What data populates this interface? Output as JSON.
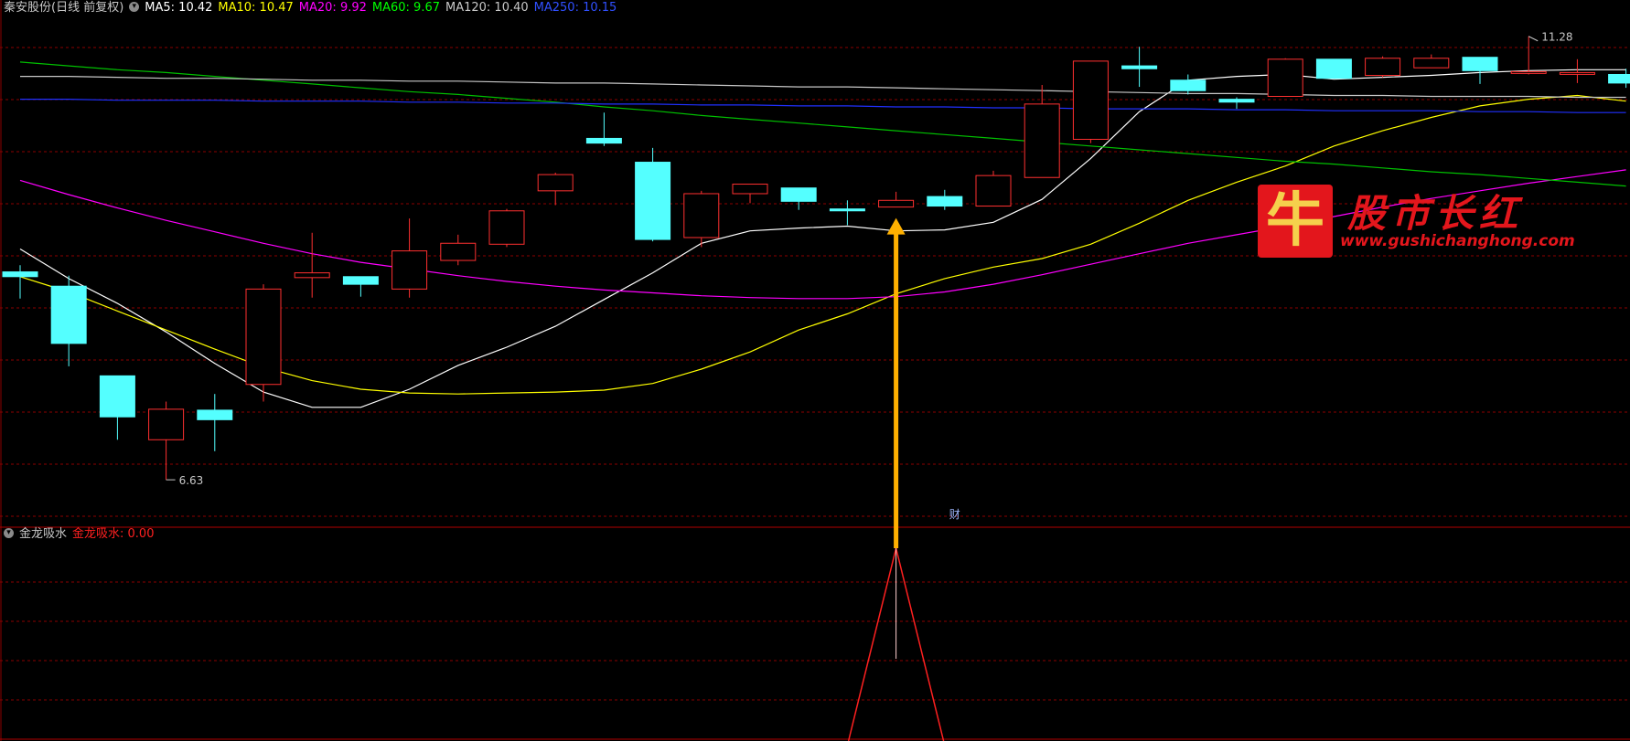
{
  "header": {
    "stock_title": "秦安股份(日线 前复权)",
    "ma_labels": [
      {
        "text": "MA5: 10.42",
        "color": "#ffffff"
      },
      {
        "text": "MA10: 10.47",
        "color": "#ffff00"
      },
      {
        "text": "MA20: 9.92",
        "color": "#ff00ff"
      },
      {
        "text": "MA60: 9.67",
        "color": "#00ff00"
      },
      {
        "text": "MA120: 10.40",
        "color": "#c8c8c8"
      },
      {
        "text": "MA250: 10.15",
        "color": "#3050ff"
      }
    ]
  },
  "indicator": {
    "name": "金龙吸水",
    "value_label": "金龙吸水: 0.00",
    "value_color": "#ff2020"
  },
  "annotations": {
    "high_label": "11.28",
    "low_label": "6.63",
    "fin_marker": "财"
  },
  "logo": {
    "mark_char": "牛",
    "brand_text": "股市长红",
    "url_text": "www.gushichanghong.com"
  },
  "colors": {
    "up": "#ff3030",
    "down": "#54ffff",
    "grid": "#8b0000",
    "arrow": "#ffb000",
    "ma5": "#ffffff",
    "ma10": "#ffff00",
    "ma20": "#ff00ff",
    "ma60": "#00c000",
    "ma120": "#c8c8c8",
    "ma250": "#2030ff"
  },
  "chart_data": [
    {
      "type": "candlestick",
      "ylim": [
        6.2,
        11.45
      ],
      "grid": true,
      "candles": [
        {
          "o": 8.81,
          "h": 8.88,
          "l": 8.53,
          "c": 8.76
        },
        {
          "o": 8.66,
          "h": 8.77,
          "l": 7.82,
          "c": 8.06
        },
        {
          "o": 7.72,
          "h": 7.72,
          "l": 7.05,
          "c": 7.29
        },
        {
          "o": 7.05,
          "h": 7.45,
          "l": 6.63,
          "c": 7.37
        },
        {
          "o": 7.36,
          "h": 7.53,
          "l": 6.93,
          "c": 7.26
        },
        {
          "o": 7.63,
          "h": 8.68,
          "l": 7.45,
          "c": 8.63
        },
        {
          "o": 8.75,
          "h": 9.22,
          "l": 8.54,
          "c": 8.8
        },
        {
          "o": 8.76,
          "h": 8.76,
          "l": 8.55,
          "c": 8.68
        },
        {
          "o": 8.63,
          "h": 9.37,
          "l": 8.54,
          "c": 9.03
        },
        {
          "o": 8.93,
          "h": 9.2,
          "l": 8.88,
          "c": 9.11
        },
        {
          "o": 9.1,
          "h": 9.47,
          "l": 9.07,
          "c": 9.45
        },
        {
          "o": 9.66,
          "h": 9.85,
          "l": 9.51,
          "c": 9.83
        },
        {
          "o": 10.21,
          "h": 10.48,
          "l": 10.13,
          "c": 10.16
        },
        {
          "o": 9.96,
          "h": 10.11,
          "l": 9.13,
          "c": 9.15
        },
        {
          "o": 9.17,
          "h": 9.66,
          "l": 9.07,
          "c": 9.63
        },
        {
          "o": 9.63,
          "h": 9.73,
          "l": 9.53,
          "c": 9.73
        },
        {
          "o": 9.69,
          "h": 9.69,
          "l": 9.46,
          "c": 9.55
        },
        {
          "o": 9.47,
          "h": 9.56,
          "l": 9.3,
          "c": 9.45
        },
        {
          "o": 9.49,
          "h": 9.65,
          "l": 9.49,
          "c": 9.56
        },
        {
          "o": 9.6,
          "h": 9.67,
          "l": 9.46,
          "c": 9.5
        },
        {
          "o": 9.5,
          "h": 9.87,
          "l": 9.5,
          "c": 9.82
        },
        {
          "o": 9.8,
          "h": 10.77,
          "l": 9.8,
          "c": 10.57
        },
        {
          "o": 10.2,
          "h": 11.02,
          "l": 10.16,
          "c": 11.02
        },
        {
          "o": 10.97,
          "h": 11.17,
          "l": 10.75,
          "c": 10.94
        },
        {
          "o": 10.82,
          "h": 10.88,
          "l": 10.67,
          "c": 10.71
        },
        {
          "o": 10.62,
          "h": 10.64,
          "l": 10.52,
          "c": 10.59
        },
        {
          "o": 10.65,
          "h": 11.05,
          "l": 10.65,
          "c": 11.04
        },
        {
          "o": 11.04,
          "h": 11.04,
          "l": 10.84,
          "c": 10.84
        },
        {
          "o": 10.87,
          "h": 11.07,
          "l": 10.85,
          "c": 11.05
        },
        {
          "o": 10.95,
          "h": 11.09,
          "l": 10.95,
          "c": 11.05
        },
        {
          "o": 11.06,
          "h": 11.06,
          "l": 10.78,
          "c": 10.92
        },
        {
          "o": 10.91,
          "h": 11.28,
          "l": 10.88,
          "c": 10.91
        },
        {
          "o": 10.9,
          "h": 11.04,
          "l": 10.79,
          "c": 10.9
        },
        {
          "o": 10.88,
          "h": 10.94,
          "l": 10.74,
          "c": 10.79
        }
      ],
      "ma_series": [
        {
          "name": "MA5",
          "values": [
            9.05,
            8.74,
            8.48,
            8.18,
            7.85,
            7.55,
            7.39,
            7.39,
            7.58,
            7.83,
            8.02,
            8.24,
            8.52,
            8.8,
            9.11,
            9.24,
            9.27,
            9.29,
            9.24,
            9.25,
            9.33,
            9.57,
            10.0,
            10.49,
            10.82,
            10.86,
            10.88,
            10.83,
            10.85,
            10.87,
            10.9,
            10.92,
            10.93,
            10.93
          ]
        },
        {
          "name": "MA10",
          "values": [
            8.76,
            8.6,
            8.4,
            8.2,
            8.0,
            7.81,
            7.67,
            7.58,
            7.54,
            7.53,
            7.54,
            7.55,
            7.57,
            7.64,
            7.79,
            7.97,
            8.2,
            8.37,
            8.58,
            8.74,
            8.86,
            8.95,
            9.1,
            9.32,
            9.56,
            9.75,
            9.92,
            10.13,
            10.29,
            10.43,
            10.55,
            10.62,
            10.66,
            10.6
          ]
        },
        {
          "name": "MA20",
          "values": [
            9.77,
            9.62,
            9.48,
            9.35,
            9.23,
            9.11,
            9.0,
            8.91,
            8.84,
            8.77,
            8.71,
            8.66,
            8.62,
            8.59,
            8.56,
            8.54,
            8.53,
            8.53,
            8.55,
            8.6,
            8.68,
            8.78,
            8.89,
            9.0,
            9.11,
            9.2,
            9.29,
            9.39,
            9.49,
            9.58,
            9.66,
            9.74,
            9.81,
            9.88
          ]
        },
        {
          "name": "MA60",
          "values": [
            11.01,
            10.97,
            10.93,
            10.9,
            10.86,
            10.82,
            10.78,
            10.74,
            10.7,
            10.67,
            10.63,
            10.59,
            10.54,
            10.5,
            10.45,
            10.41,
            10.37,
            10.33,
            10.29,
            10.25,
            10.21,
            10.17,
            10.13,
            10.09,
            10.05,
            10.01,
            9.97,
            9.94,
            9.9,
            9.86,
            9.83,
            9.79,
            9.75,
            9.71
          ]
        },
        {
          "name": "MA120",
          "values": [
            10.86,
            10.86,
            10.85,
            10.84,
            10.84,
            10.83,
            10.82,
            10.82,
            10.81,
            10.81,
            10.8,
            10.79,
            10.79,
            10.78,
            10.77,
            10.76,
            10.75,
            10.75,
            10.74,
            10.73,
            10.72,
            10.71,
            10.7,
            10.69,
            10.68,
            10.68,
            10.67,
            10.66,
            10.66,
            10.65,
            10.65,
            10.65,
            10.64,
            10.64
          ]
        },
        {
          "name": "MA250",
          "values": [
            10.62,
            10.62,
            10.61,
            10.61,
            10.61,
            10.6,
            10.6,
            10.6,
            10.59,
            10.59,
            10.58,
            10.58,
            10.57,
            10.57,
            10.56,
            10.56,
            10.55,
            10.55,
            10.54,
            10.54,
            10.53,
            10.53,
            10.52,
            10.52,
            10.52,
            10.51,
            10.51,
            10.5,
            10.5,
            10.5,
            10.49,
            10.49,
            10.48,
            10.48
          ]
        }
      ]
    },
    {
      "type": "line",
      "series": [
        {
          "name": "金龙吸水",
          "values": [
            0,
            0,
            0,
            0,
            0,
            0,
            0,
            0,
            0,
            0,
            0,
            0,
            0,
            0,
            0,
            0,
            0,
            0,
            1,
            0,
            0,
            0,
            0,
            0,
            0,
            0,
            0,
            0,
            0,
            0,
            0,
            0,
            0,
            0
          ]
        }
      ],
      "ylim": [
        0,
        1
      ]
    }
  ]
}
